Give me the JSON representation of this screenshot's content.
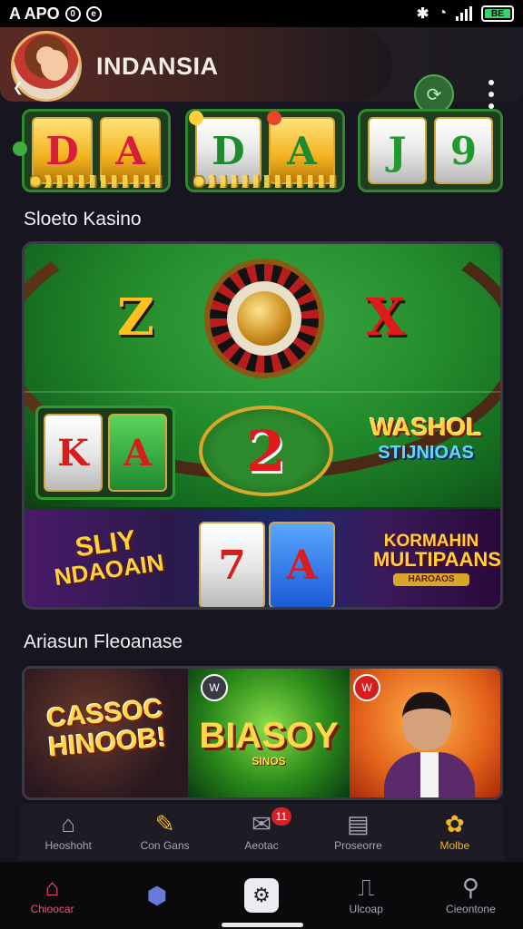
{
  "status_bar": {
    "carrier": "A APO",
    "icon_a": "0",
    "icon_b": "e",
    "battery": "BE",
    "icons": [
      "bluetooth-icon",
      "wifi-icon",
      "signal-icon",
      "battery-icon"
    ]
  },
  "header": {
    "title": "INDANSIA",
    "back_glyph": "❮",
    "action_glyph": "⟳",
    "colors": {
      "accent_green": "#2f6a34"
    }
  },
  "top_reels": [
    {
      "symbols": [
        "D",
        "A"
      ]
    },
    {
      "symbols": [
        "D",
        "A"
      ]
    },
    {
      "symbols": [
        "J",
        "9"
      ]
    }
  ],
  "sections": {
    "slots_title": "Sloeto Kasino",
    "promo_title": "Ariasun Fleoanase"
  },
  "casino_panel": {
    "felt_letters": [
      "Z",
      "X"
    ],
    "mini_reels": [
      "K",
      "A"
    ],
    "chip_number": "2",
    "logo1": {
      "line1": "WASHOL",
      "line2": "STIJNIOAS"
    },
    "logo2": {
      "line1": "SLIY",
      "line2": "NDAOAIN"
    },
    "strip_reels": [
      "7",
      "A"
    ],
    "logo3": {
      "line1": "KORMAHIN",
      "line2": "MULTIPAANS",
      "line3": "HAROAOS"
    }
  },
  "promo": {
    "p1": "CASSOC HINOOB!",
    "p2_title": "BIASOY",
    "p2_sub": "SINOS",
    "tags": [
      "W",
      "W"
    ]
  },
  "nav_top": [
    {
      "label": "Heoshoht",
      "icon": "⌂",
      "name": "home-icon"
    },
    {
      "label": "Con Gans",
      "icon": "✎",
      "name": "edit-icon"
    },
    {
      "label": "Aeotac",
      "icon": "✉",
      "name": "mail-icon",
      "badge": "11"
    },
    {
      "label": "Proseorre",
      "icon": "▤",
      "name": "window-icon"
    },
    {
      "label": "Molbe",
      "icon": "✿",
      "name": "gear-icon",
      "active": true
    }
  ],
  "nav_bottom": [
    {
      "label": "Chioocar",
      "icon": "⌂",
      "name": "home-icon",
      "active": true
    },
    {
      "label": "",
      "icon": "⬢",
      "name": "shield-icon"
    },
    {
      "label": "",
      "icon": "⚙",
      "name": "tile-icon"
    },
    {
      "label": "Ulcoap",
      "icon": "⎍",
      "name": "book-icon"
    },
    {
      "label": "Cieontone",
      "icon": "⚲",
      "name": "search-icon"
    }
  ]
}
